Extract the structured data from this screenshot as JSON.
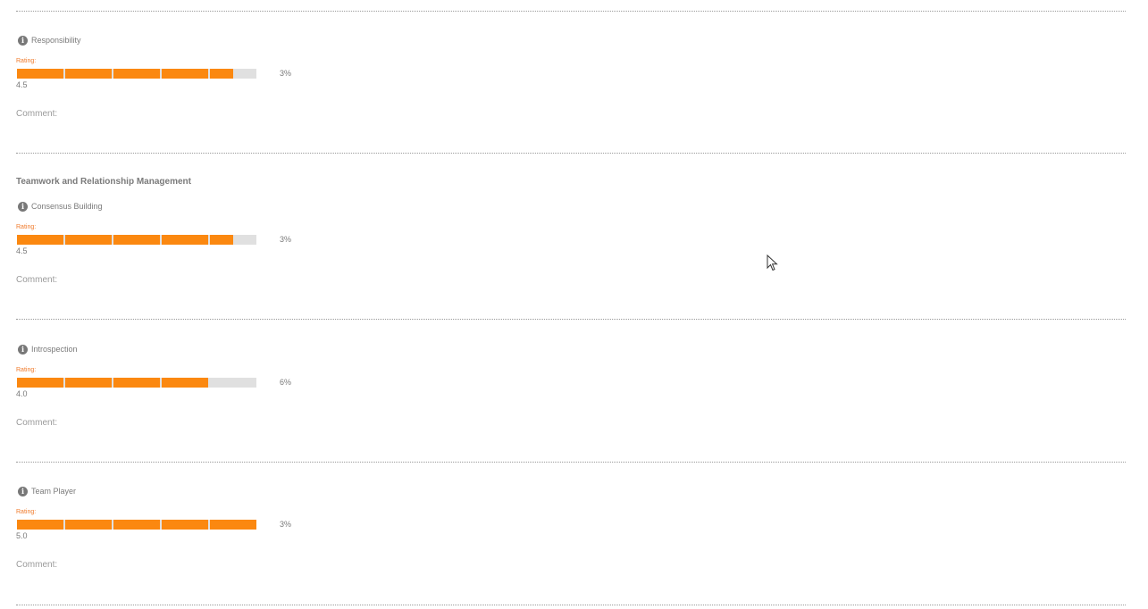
{
  "sections": [
    {
      "title": "",
      "competencies": [
        {
          "name": "Responsibility",
          "rating_label": "Rating:",
          "rating": 4.5,
          "rating_text": "4.5",
          "max": 5,
          "percent": "3%",
          "comment_label": "Comment:"
        }
      ]
    },
    {
      "title": "Teamwork and Relationship Management",
      "competencies": [
        {
          "name": "Consensus Building",
          "rating_label": "Rating:",
          "rating": 4.5,
          "rating_text": "4.5",
          "max": 5,
          "percent": "3%",
          "comment_label": "Comment:"
        },
        {
          "name": "Introspection",
          "rating_label": "Rating:",
          "rating": 4.0,
          "rating_text": "4.0",
          "max": 5,
          "percent": "6%",
          "comment_label": "Comment:"
        },
        {
          "name": "Team Player",
          "rating_label": "Rating:",
          "rating": 5.0,
          "rating_text": "5.0",
          "max": 5,
          "percent": "3%",
          "comment_label": "Comment:"
        }
      ]
    }
  ],
  "icons": {
    "info": "i",
    "cursor": "arrow-cursor"
  },
  "colors": {
    "bar_fill": "#fb8810",
    "bar_track": "#e0e0e0",
    "rating_label": "#f07a2a",
    "text": "#7a7a7a"
  }
}
